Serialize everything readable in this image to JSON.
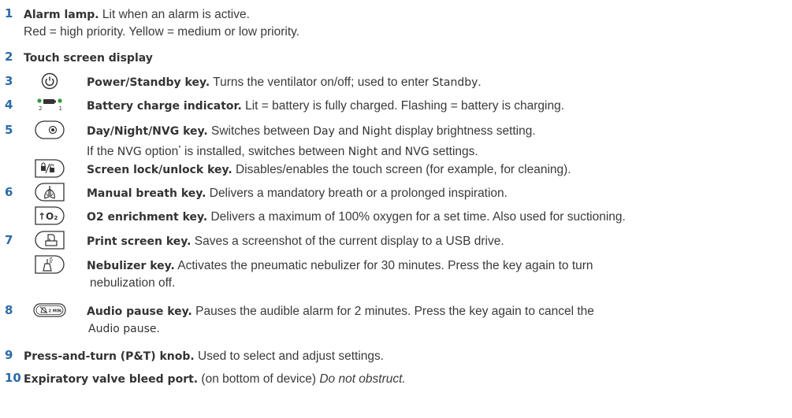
{
  "items": [
    {
      "num": "1",
      "title": "Alarm lamp.",
      "text": " Lit when an alarm is active.",
      "line2": "Red = high priority. Yellow = medium or low priority."
    },
    {
      "num": "2",
      "title": "Touch screen display"
    },
    {
      "num": "3",
      "icon": "power-standby-icon",
      "title": "Power/Standby key.",
      "text": " Turns the ventilator on/off; used to enter ",
      "key": "Standby",
      "tail": "."
    },
    {
      "num": "4",
      "icon": "battery-charge-icon",
      "icon_label_left": "2",
      "icon_label_right": "1",
      "title": "Battery charge indicator.",
      "text": " Lit = battery is fully charged. Flashing = battery is charging."
    },
    {
      "num": "5",
      "icon": "day-night-nvg-icon",
      "title": "Day/Night/NVG key.",
      "t1": " Switches between ",
      "k1": "Day",
      "t2": " and ",
      "k2": "Night",
      "t3": " display brightness setting.",
      "l2a": " If the ",
      "l2k": "NVG",
      "l2b": " option",
      "l2sup": "*",
      "l2c": " is installed, switches between ",
      "l2k2": "Night",
      "l2d": " and ",
      "l2k3": "NVG",
      "l2e": " settings."
    },
    {
      "icon": "screen-lock-icon",
      "title": "Screen lock/unlock key.",
      "text": " Disables/enables the touch screen (for example, for cleaning)."
    },
    {
      "num": "6",
      "icon": "manual-breath-icon",
      "title": "Manual breath key.",
      "text": " Delivers a mandatory breath or a prolonged inspiration."
    },
    {
      "icon": "o2-enrichment-icon",
      "icon_text": "↑O₂",
      "title": "O2 enrichment key.",
      "text": " Delivers a maximum of 100% oxygen for a set time. Also used for suctioning."
    },
    {
      "num": "7",
      "icon": "print-screen-icon",
      "title": "Print screen key.",
      "text": " Saves a screenshot of the current display to a USB drive."
    },
    {
      "icon": "nebulizer-icon",
      "title": "Nebulizer key.",
      "text": " Activates the pneumatic nebulizer for 30 minutes. Press the key again to turn",
      "line2": "nebulization off."
    },
    {
      "num": "8",
      "icon": "audio-pause-icon",
      "icon_text": "2 MIN.",
      "title": "Audio pause key.",
      "text": " Pauses the audible alarm for 2 minutes. Press the key again to cancel the",
      "line2k": "Audio pause",
      "line2": "."
    },
    {
      "num": "9",
      "title": "Press-and-turn (P&T) knob.",
      "text": " Used to select and adjust settings."
    },
    {
      "num": "10",
      "title": "Expiratory valve bleed port.",
      "text": " (on bottom of device) ",
      "italic": "Do not obstruct."
    }
  ],
  "colors": {
    "number": "#2c6aa8",
    "text": "#3a3a3a",
    "icon_stroke": "#333333",
    "green_led": "#2e9a3a"
  }
}
